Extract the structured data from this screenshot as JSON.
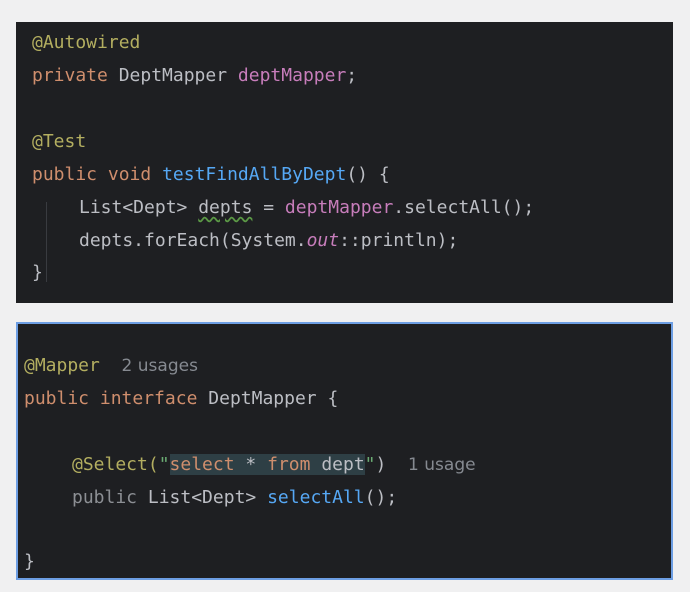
{
  "top_snippet": {
    "annotation_autowired": "@Autowired",
    "kw_private": "private",
    "type_dept_mapper": "DeptMapper",
    "field_dept_mapper": "deptMapper",
    "semicolon": ";",
    "annotation_test": "@Test",
    "kw_public": "public",
    "kw_void": "void",
    "method_name": "testFindAllByDept",
    "parens_brace": "() {",
    "list_decl": "List<Dept>",
    "var_depts": "depts",
    "assign": " = ",
    "field_ref": "deptMapper",
    "call_select_all": ".selectAll();",
    "foreach_call": "depts.forEach(System.",
    "out_field": "out",
    "println_ref": "::println);",
    "closing_brace": "}"
  },
  "bottom_snippet": {
    "annotation_mapper": "@Mapper",
    "mapper_usages": "2 usages",
    "kw_public": "public",
    "kw_interface": "interface",
    "interface_name": "DeptMapper {",
    "annotation_select": "@Select(",
    "quote_open": "\"",
    "sql_select": "select",
    "sql_star": "*",
    "sql_from": "from",
    "sql_table": "dept",
    "quote_close": "\"",
    "paren_close": ")",
    "select_usage": "1 usage",
    "kw_public_dim": "public",
    "return_type": "List<Dept>",
    "method_select_all": "selectAll",
    "method_end": "();",
    "closing_brace": "}"
  },
  "colors": {
    "editor_background": "#1e1f22",
    "annotation": "#b3ae60",
    "keyword": "#cf8e6d",
    "field": "#c77dbb",
    "method": "#56a8f5",
    "selection_border": "#6d9ee3"
  }
}
